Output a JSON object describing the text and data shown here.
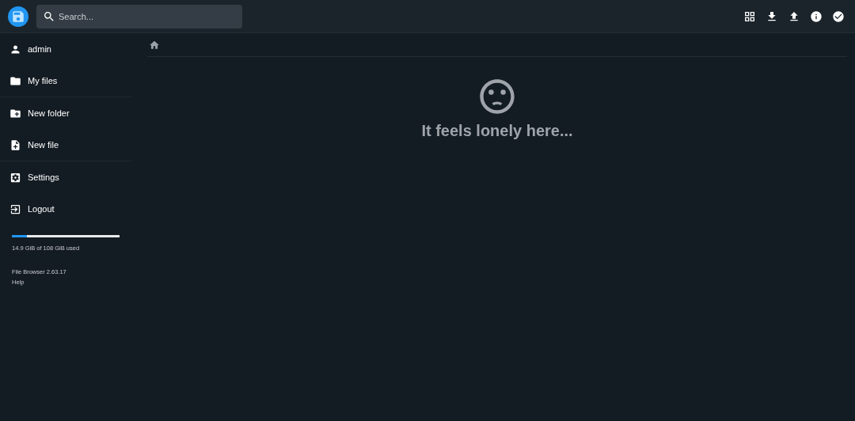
{
  "header": {
    "search": {
      "placeholder": "Search..."
    }
  },
  "sidebar": {
    "groups": [
      [
        {
          "label": "admin"
        },
        {
          "label": "My files"
        }
      ],
      [
        {
          "label": "New folder"
        },
        {
          "label": "New file"
        }
      ],
      [
        {
          "label": "Settings"
        },
        {
          "label": "Logout"
        }
      ]
    ],
    "storage": {
      "level": 0.14,
      "reading": "14.9 GiB of 108 GiB used"
    },
    "version": "File Browser 2.63.17",
    "help": "Help"
  },
  "empty": {
    "message": "It feels lonely here..."
  }
}
